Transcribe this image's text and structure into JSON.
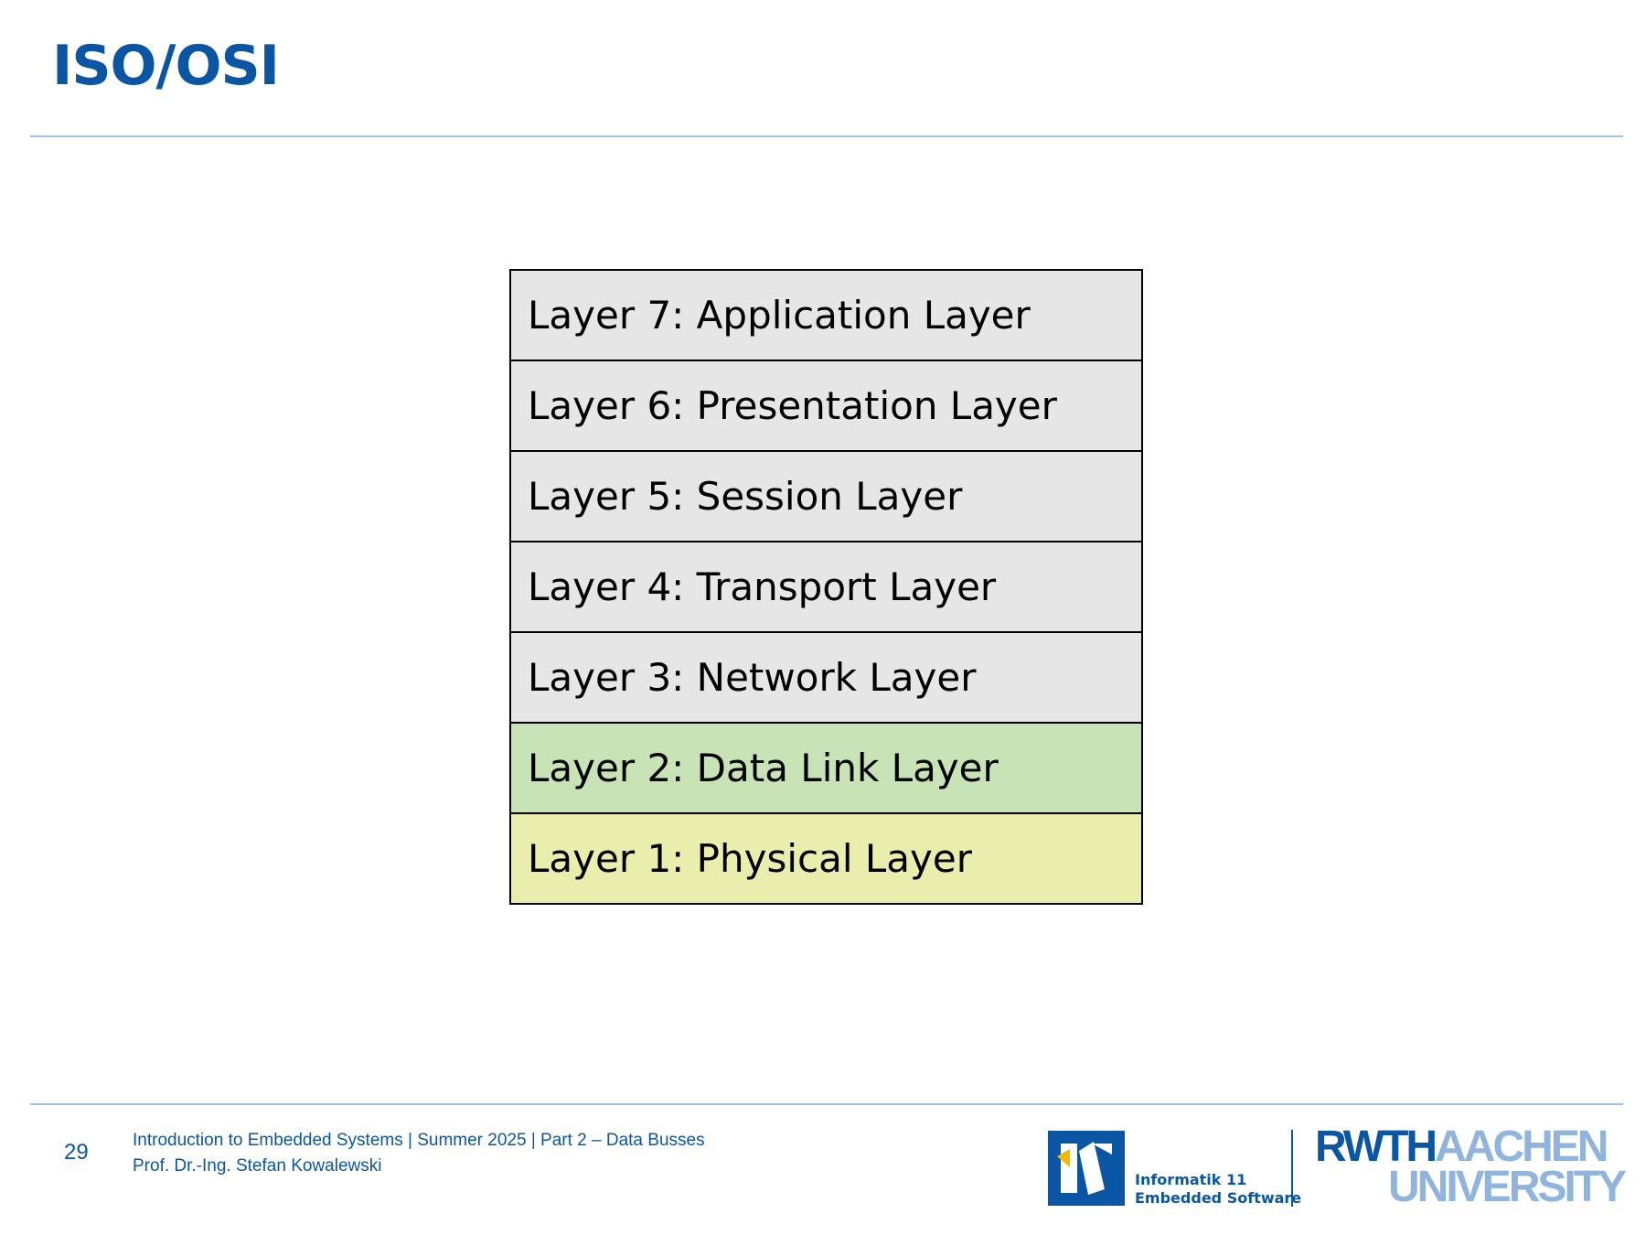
{
  "slide": {
    "title": "ISO/OSI"
  },
  "layers": [
    {
      "label": "Layer 7: Application Layer",
      "color": "#e6e6e6"
    },
    {
      "label": "Layer 6: Presentation Layer",
      "color": "#e6e6e6"
    },
    {
      "label": "Layer 5: Session Layer",
      "color": "#e6e6e6"
    },
    {
      "label": "Layer 4: Transport Layer",
      "color": "#e6e6e6"
    },
    {
      "label": "Layer 3: Network Layer",
      "color": "#e6e6e6"
    },
    {
      "label": "Layer 2: Data Link Layer",
      "color": "#c8e3b5"
    },
    {
      "label": "Layer 1: Physical Layer",
      "color": "#e9eeac"
    }
  ],
  "footer": {
    "page_number": "29",
    "course_line": "Introduction to Embedded Systems | Summer 2025 | Part 2 – Data Busses",
    "author_line": "Prof. Dr.-Ing. Stefan Kowalewski"
  },
  "logos": {
    "i11_line1": "Informatik 11",
    "i11_line2": "Embedded Software",
    "rwth_part1": "RWTH",
    "rwth_part2": "AACHEN",
    "rwth_part3": "UNIVERSITY"
  },
  "colors": {
    "brand_blue": "#0b56a4",
    "light_blue": "#8fb5de",
    "rule": "#9ec3e6",
    "logo_yellow": "#f5b800"
  }
}
